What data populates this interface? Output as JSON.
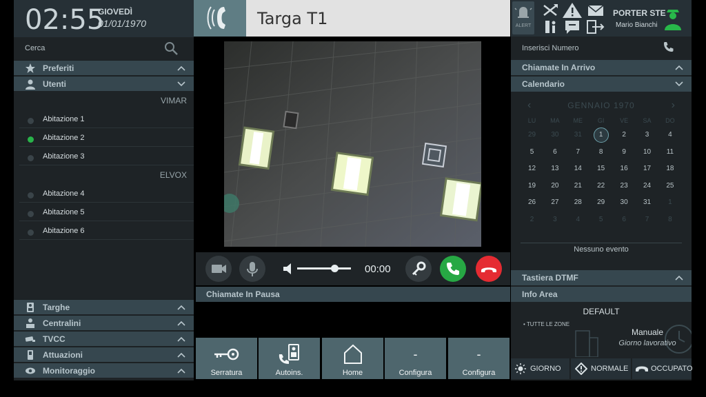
{
  "clock": {
    "time": "02:55",
    "day": "GIOVEDÌ",
    "date": "01/01/1970"
  },
  "search": {
    "label": "Cerca",
    "icon": "search-icon"
  },
  "sidebar": {
    "preferiti": "Preferiti",
    "utenti": "Utenti",
    "groups": [
      {
        "name": "VIMAR",
        "items": [
          {
            "label": "Abitazione 1",
            "online": false
          },
          {
            "label": "Abitazione 2",
            "online": true
          },
          {
            "label": "Abitazione 3",
            "online": false
          }
        ]
      },
      {
        "name": "ELVOX",
        "items": [
          {
            "label": "Abitazione 4",
            "online": false
          },
          {
            "label": "Abitazione 5",
            "online": false
          },
          {
            "label": "Abitazione 6",
            "online": false
          }
        ]
      }
    ],
    "bottom": [
      "Targhe",
      "Centralini",
      "TVCC",
      "Attuazioni",
      "Monitoraggio"
    ]
  },
  "call": {
    "title": "Targa T1",
    "timer": "00:00",
    "volume": 0.7
  },
  "paused": {
    "label": "Chiamate In Pausa"
  },
  "actions": [
    {
      "label": "Serratura",
      "icon": "key-icon"
    },
    {
      "label": "Autoins.",
      "icon": "autoinsert-icon"
    },
    {
      "label": "Home",
      "icon": "home-icon"
    },
    {
      "label": "Configura",
      "symbol": "-"
    },
    {
      "label": "Configura",
      "symbol": "-"
    }
  ],
  "topbar": {
    "alert": "ALERT",
    "porter": "PORTER STE",
    "user": "Mario Bianchi"
  },
  "right": {
    "number_placeholder": "Inserisci Numero",
    "incoming": "Chiamate In Arrivo",
    "calendar": "Calendario",
    "month": "GENNAIO",
    "year": "1970",
    "dow": [
      "LU",
      "MA",
      "ME",
      "GI",
      "VE",
      "SA",
      "DO"
    ],
    "weeks": [
      [
        [
          "29",
          1
        ],
        [
          "30",
          1
        ],
        [
          "31",
          1
        ],
        [
          "1",
          2
        ],
        [
          "2",
          0
        ],
        [
          "3",
          0
        ],
        [
          "4",
          0
        ]
      ],
      [
        [
          "5",
          0
        ],
        [
          "6",
          0
        ],
        [
          "7",
          0
        ],
        [
          "8",
          0
        ],
        [
          "9",
          0
        ],
        [
          "10",
          0
        ],
        [
          "11",
          0
        ]
      ],
      [
        [
          "12",
          0
        ],
        [
          "13",
          0
        ],
        [
          "14",
          0
        ],
        [
          "15",
          0
        ],
        [
          "16",
          0
        ],
        [
          "17",
          0
        ],
        [
          "18",
          0
        ]
      ],
      [
        [
          "19",
          0
        ],
        [
          "20",
          0
        ],
        [
          "21",
          0
        ],
        [
          "22",
          0
        ],
        [
          "23",
          0
        ],
        [
          "24",
          0
        ],
        [
          "25",
          0
        ]
      ],
      [
        [
          "26",
          0
        ],
        [
          "27",
          0
        ],
        [
          "28",
          0
        ],
        [
          "29",
          0
        ],
        [
          "30",
          0
        ],
        [
          "31",
          0
        ],
        [
          "1",
          1
        ]
      ],
      [
        [
          "2",
          1
        ],
        [
          "3",
          1
        ],
        [
          "4",
          1
        ],
        [
          "5",
          1
        ],
        [
          "6",
          1
        ],
        [
          "7",
          1
        ],
        [
          "8",
          1
        ]
      ]
    ],
    "no_events": "Nessuno evento",
    "dtmf": "Tastiera DTMF",
    "info": "Info Area",
    "default": "DEFAULT",
    "zones": "TUTTE LE ZONE",
    "mode": "Manuale",
    "mode_sub": "Giorno lavorativo",
    "modes": [
      "GIORNO",
      "NORMALE",
      "OCCUPATO"
    ]
  }
}
